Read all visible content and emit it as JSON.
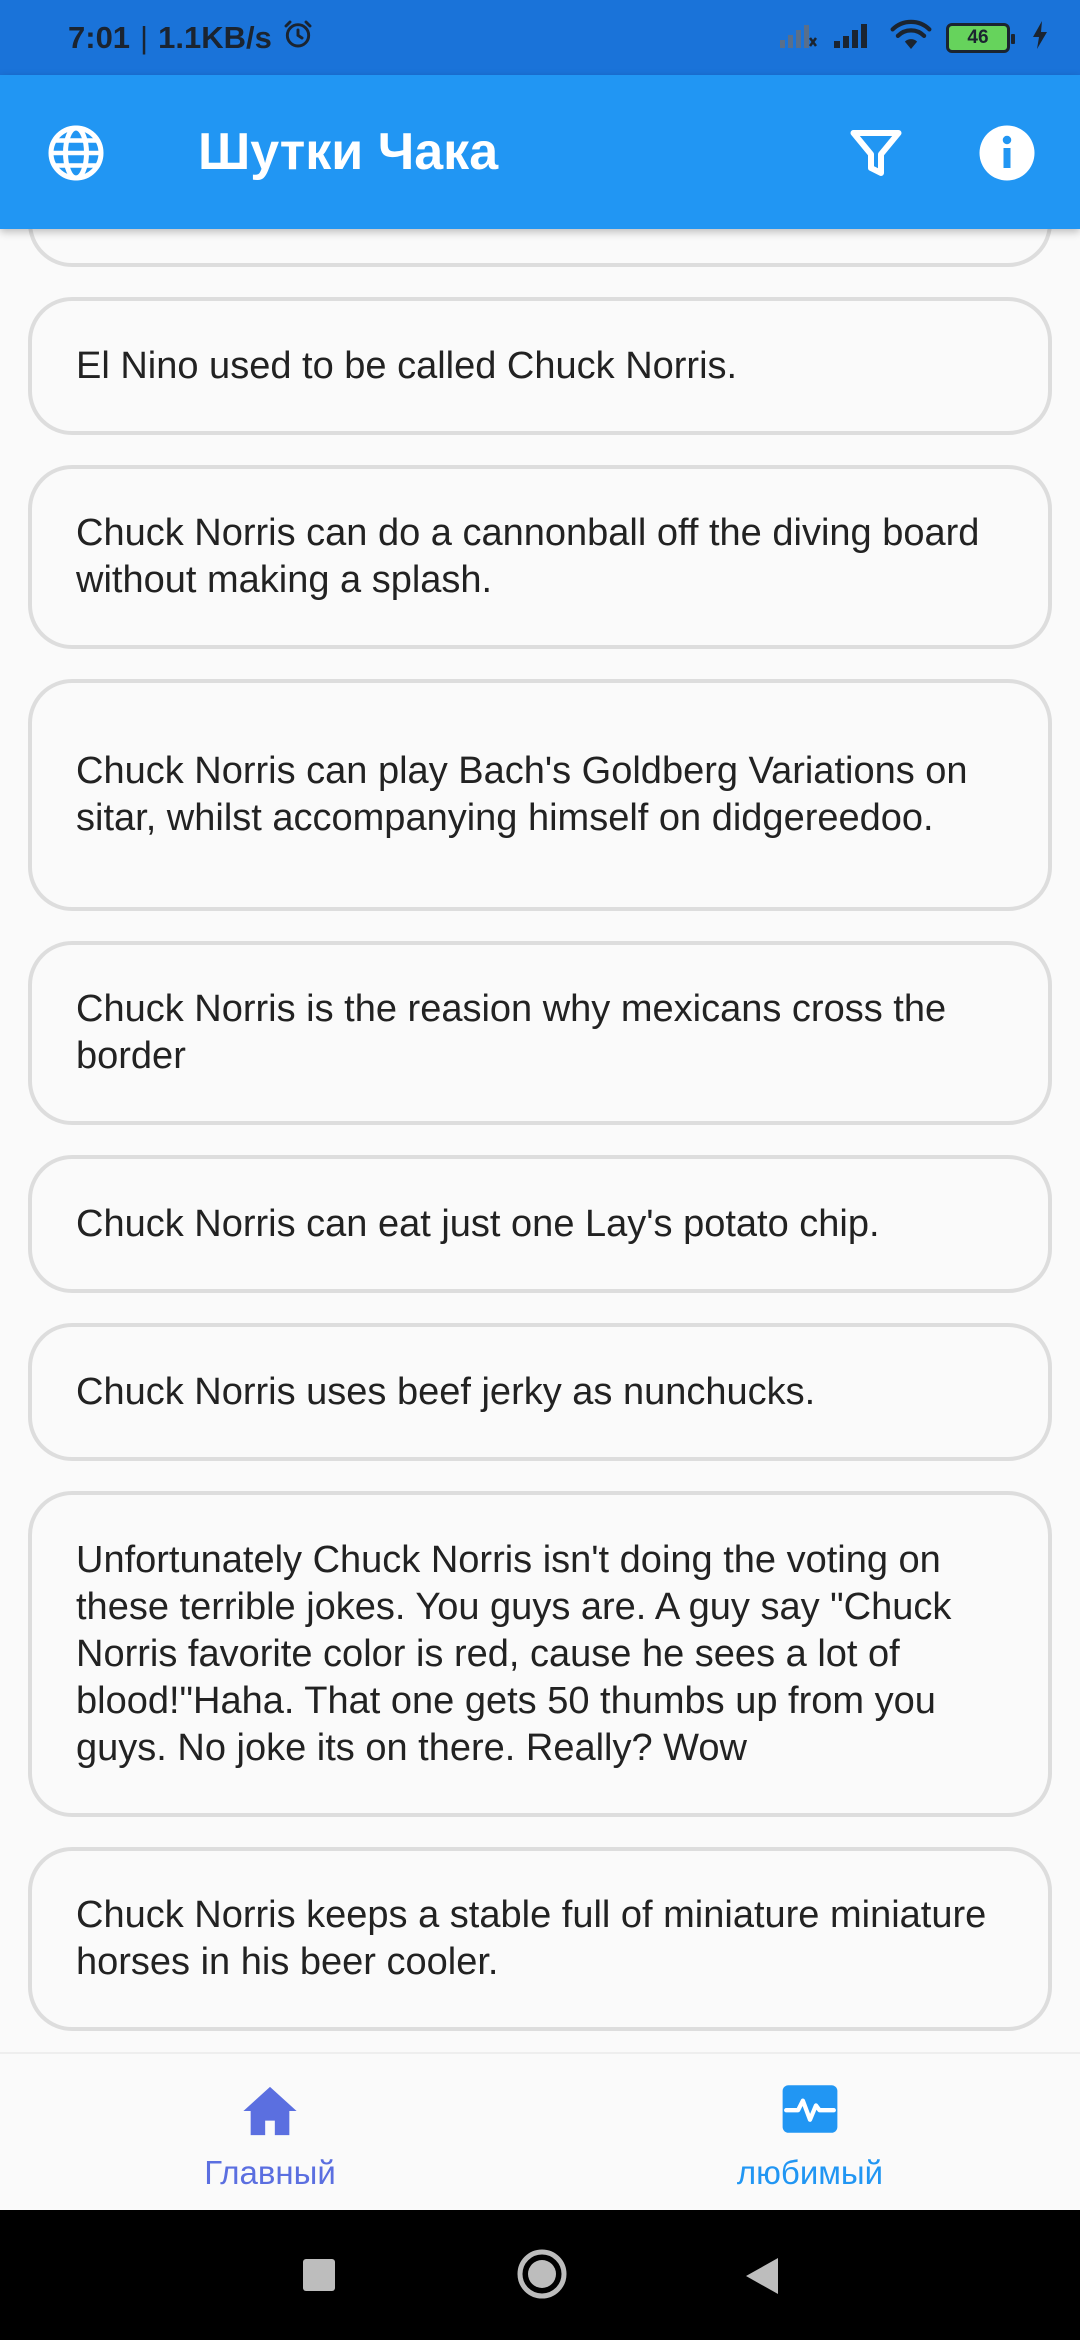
{
  "status_bar": {
    "time": "7:01",
    "separator": "|",
    "net_speed": "1.1KB/s",
    "battery": "46"
  },
  "app_bar": {
    "title": "Шутки Чака",
    "icons": [
      "globe-icon",
      "filter-icon",
      "info-icon"
    ]
  },
  "jokes": [
    "",
    "El Nino used to be called Chuck Norris.",
    "Chuck Norris can do a cannonball off the diving board without making a splash.",
    "Chuck Norris can play Bach's Goldberg Variations on sitar, whilst accompanying himself on didgereedoo.",
    "Chuck Norris is the reasion why mexicans cross the border",
    "Chuck Norris can eat just one Lay's potato chip.",
    "Chuck Norris uses beef jerky as nunchucks.",
    "Unfortunately Chuck Norris isn't doing the voting on these terrible jokes. You guys are. A guy say \"Chuck Norris favorite color is red, cause he sees a lot of blood!\"Haha. That one gets 50 thumbs up from you guys. No joke its on there. Really? Wow",
    "Chuck Norris keeps a stable full of miniature miniature horses in his beer cooler."
  ],
  "bottom_nav": {
    "home_label": "Главный",
    "favorites_label": "любимый"
  },
  "colors": {
    "app_bar": "#2196f3",
    "status_bar": "#1a73d9",
    "card_border": "#dddddd",
    "home_active": "#5b6fe0",
    "favorites": "#2196f3"
  }
}
